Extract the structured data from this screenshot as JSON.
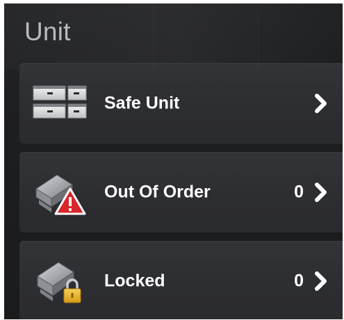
{
  "panel": {
    "title": "Unit"
  },
  "items": [
    {
      "label": "Safe Unit",
      "count": "",
      "icon": "safe-unit-icon",
      "arrow": "chevron-right-icon"
    },
    {
      "label": "Out Of Order",
      "count": "0",
      "icon": "out-of-order-icon",
      "arrow": "chevron-right-icon"
    },
    {
      "label": "Locked",
      "count": "0",
      "icon": "locked-icon",
      "arrow": "chevron-right-icon"
    }
  ],
  "colors": {
    "panel_bg": "#1d1e20",
    "row_bg": "#2f3033",
    "title": "#b9bbbf",
    "text": "#ffffff",
    "warning_red": "#d9262b",
    "lock_gold": "#e8b22a"
  }
}
